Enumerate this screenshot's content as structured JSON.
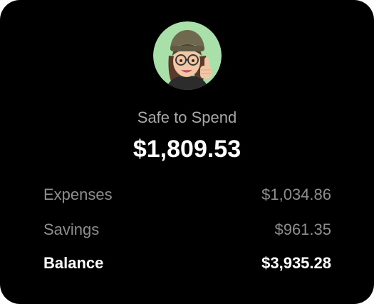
{
  "colors": {
    "background": "#000000",
    "muted_text": "#8e8e8e",
    "primary_text": "#ffffff",
    "avatar_bg": "#a9dfa8"
  },
  "avatar": {
    "icon": "memoji-thumbs-up-avatar"
  },
  "safe_to_spend": {
    "label": "Safe to Spend",
    "amount": "$1,809.53"
  },
  "rows": [
    {
      "label": "Expenses",
      "value": "$1,034.86"
    },
    {
      "label": "Savings",
      "value": "$961.35"
    },
    {
      "label": "Balance",
      "value": "$3,935.28"
    }
  ]
}
